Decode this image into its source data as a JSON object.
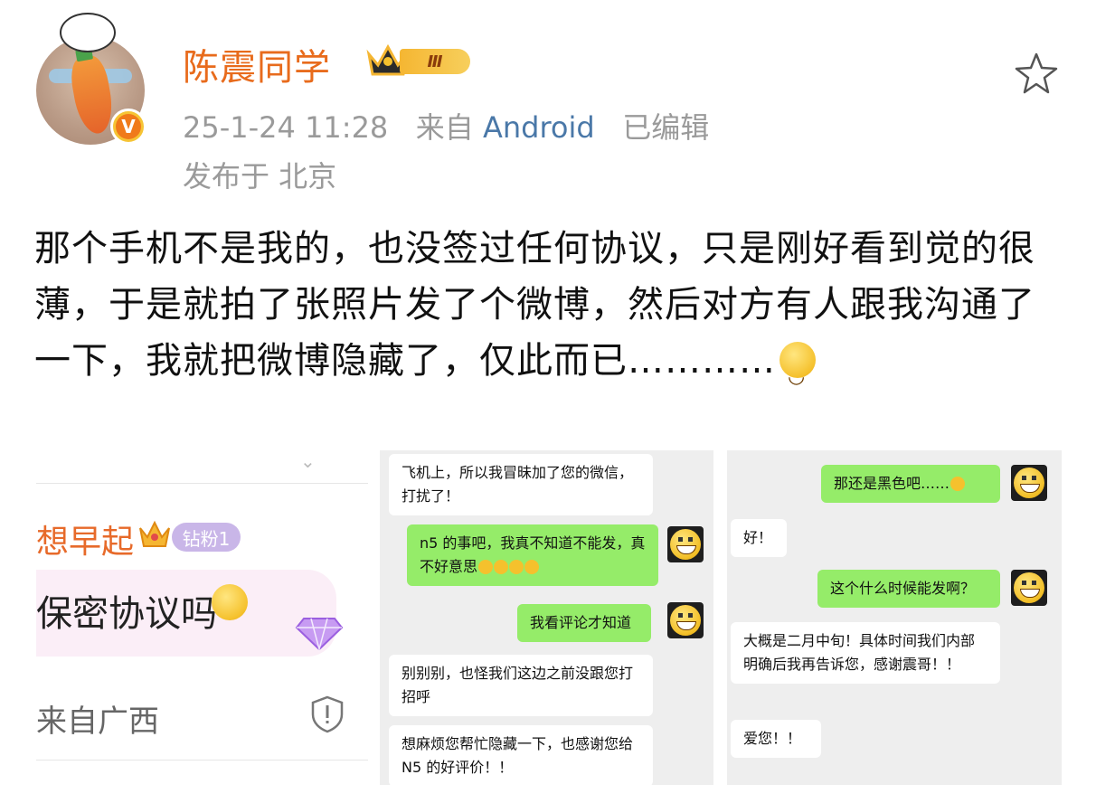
{
  "author": {
    "name": "陈震同学",
    "level_badge": "Ⅲ",
    "verified_badge": "V"
  },
  "meta": {
    "date": "25-1-24 11:28",
    "from_label": "来自",
    "source": "Android",
    "edited": "已编辑",
    "location": "发布于 北京"
  },
  "post": {
    "text": "那个手机不是我的，也没签过任何协议，只是刚好看到觉的很薄，于是就拍了张照片发了个微博，然后对方有人跟我沟通了一下，我就把微博隐藏了，仅此而已…………",
    "emoji": "smile-emoji"
  },
  "image1": {
    "name": "想早起",
    "badge": "钻粉1",
    "comment": "保密协议吗",
    "location": "来自广西"
  },
  "image2": {
    "messages": [
      {
        "side": "left",
        "text": "飞机上，所以我冒昧加了您的微信，打扰了！"
      },
      {
        "side": "right",
        "text": "n5 的事吧，我真不知道不能发，真不好意思"
      },
      {
        "side": "right",
        "text": "我看评论才知道"
      },
      {
        "side": "left",
        "text": "别别别，也怪我们这边之前没跟您打招呼"
      },
      {
        "side": "left",
        "text": "想麻烦您帮忙隐藏一下，也感谢您给 N5 的好评价！！"
      }
    ]
  },
  "image3": {
    "messages": [
      {
        "side": "right",
        "text": "那还是黑色吧……"
      },
      {
        "side": "left",
        "text": "好！"
      },
      {
        "side": "right",
        "text": "这个什么时候能发啊？"
      },
      {
        "side": "left",
        "text": "大概是二月中旬！具体时间我们内部明确后我再告诉您，感谢震哥！！"
      },
      {
        "side": "left",
        "text": "爱您！！"
      }
    ]
  },
  "colors": {
    "username": "#e86b1c",
    "source_link": "#4a78a8",
    "meta_gray": "#9a9a9a",
    "wechat_green": "#95ec69"
  }
}
